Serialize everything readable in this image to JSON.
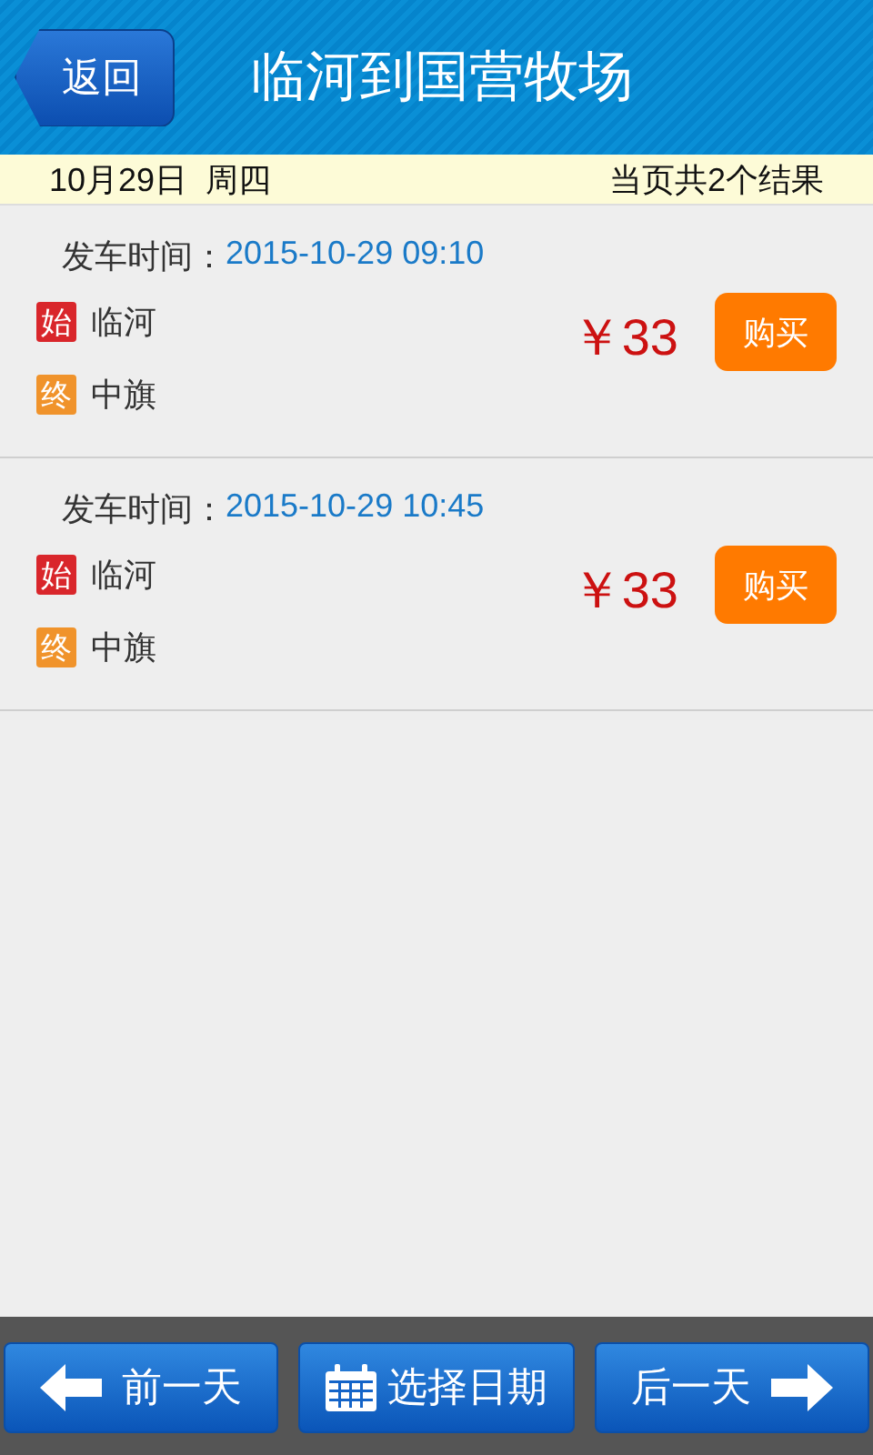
{
  "header": {
    "back_label": "返回",
    "title": "临河到国营牧场"
  },
  "info_bar": {
    "date": "10月29日  周四",
    "result_count": "当页共2个结果"
  },
  "trips": [
    {
      "departure_label": "发车时间：",
      "departure_time": "2015-10-29 09:10",
      "start_badge": "始",
      "start": "临河",
      "end_badge": "终",
      "end": "中旗",
      "price": "￥33",
      "buy_label": "购买"
    },
    {
      "departure_label": "发车时间：",
      "departure_time": "2015-10-29 10:45",
      "start_badge": "始",
      "start": "临河",
      "end_badge": "终",
      "end": "中旗",
      "price": "￥33",
      "buy_label": "购买"
    }
  ],
  "bottom_bar": [
    {
      "kind": "prev",
      "label": "前一天"
    },
    {
      "kind": "calendar",
      "label": "选择日期"
    },
    {
      "kind": "next",
      "label": "后一天"
    }
  ]
}
